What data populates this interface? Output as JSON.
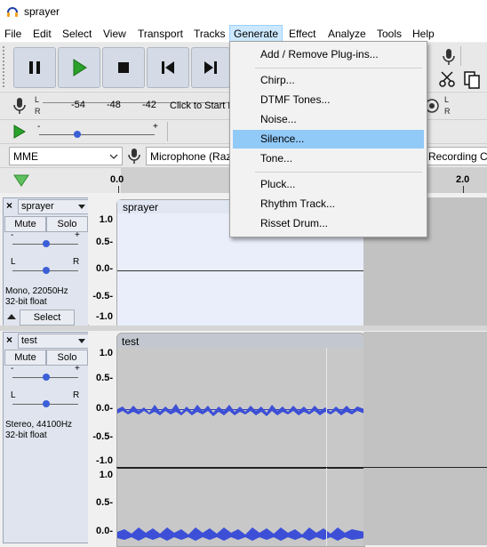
{
  "window": {
    "title": "sprayer"
  },
  "menubar": {
    "items": [
      "File",
      "Edit",
      "Select",
      "View",
      "Transport",
      "Tracks",
      "Generate",
      "Effect",
      "Analyze",
      "Tools",
      "Help"
    ],
    "active": "Generate"
  },
  "generate_menu": {
    "groups": [
      [
        "Add / Remove Plug-ins..."
      ],
      [
        "Chirp...",
        "DTMF Tones...",
        "Noise...",
        "Silence...",
        "Tone..."
      ],
      [
        "Pluck...",
        "Rhythm Track...",
        "Risset Drum..."
      ]
    ],
    "highlighted": "Silence..."
  },
  "meter": {
    "ticks": [
      "-54",
      "-48",
      "-42"
    ],
    "click_text": "Click to Start M",
    "l": "L",
    "r": "R"
  },
  "device": {
    "host": "MME",
    "input": "Microphone (Raz",
    "recording": "Recording Ch"
  },
  "ruler": {
    "start": "0.0",
    "mark": "2.0"
  },
  "tracks": [
    {
      "name": "sprayer",
      "mute": "Mute",
      "solo": "Solo",
      "info_line1": "Mono, 22050Hz",
      "info_line2": "32-bit float",
      "select": "Select",
      "clip_name": "sprayer",
      "scale": [
        "1.0",
        "0.5-",
        "0.0-",
        "-0.5-",
        "-1.0"
      ]
    },
    {
      "name": "test",
      "mute": "Mute",
      "solo": "Solo",
      "info_line1": "Stereo, 44100Hz",
      "info_line2": "32-bit float",
      "clip_name": "test",
      "scale": [
        "1.0",
        "0.5-",
        "0.0-",
        "-0.5-",
        "-1.0",
        "1.0",
        "0.5-",
        "0.0-"
      ]
    }
  ],
  "gain_slider": {
    "minus": "-",
    "plus": "+"
  },
  "pan_slider": {
    "l": "L",
    "r": "R"
  },
  "colors": {
    "wave": "#3c4fd6",
    "menu_highlight": "#91c9f7",
    "track_panel": "#dfe4ee"
  }
}
